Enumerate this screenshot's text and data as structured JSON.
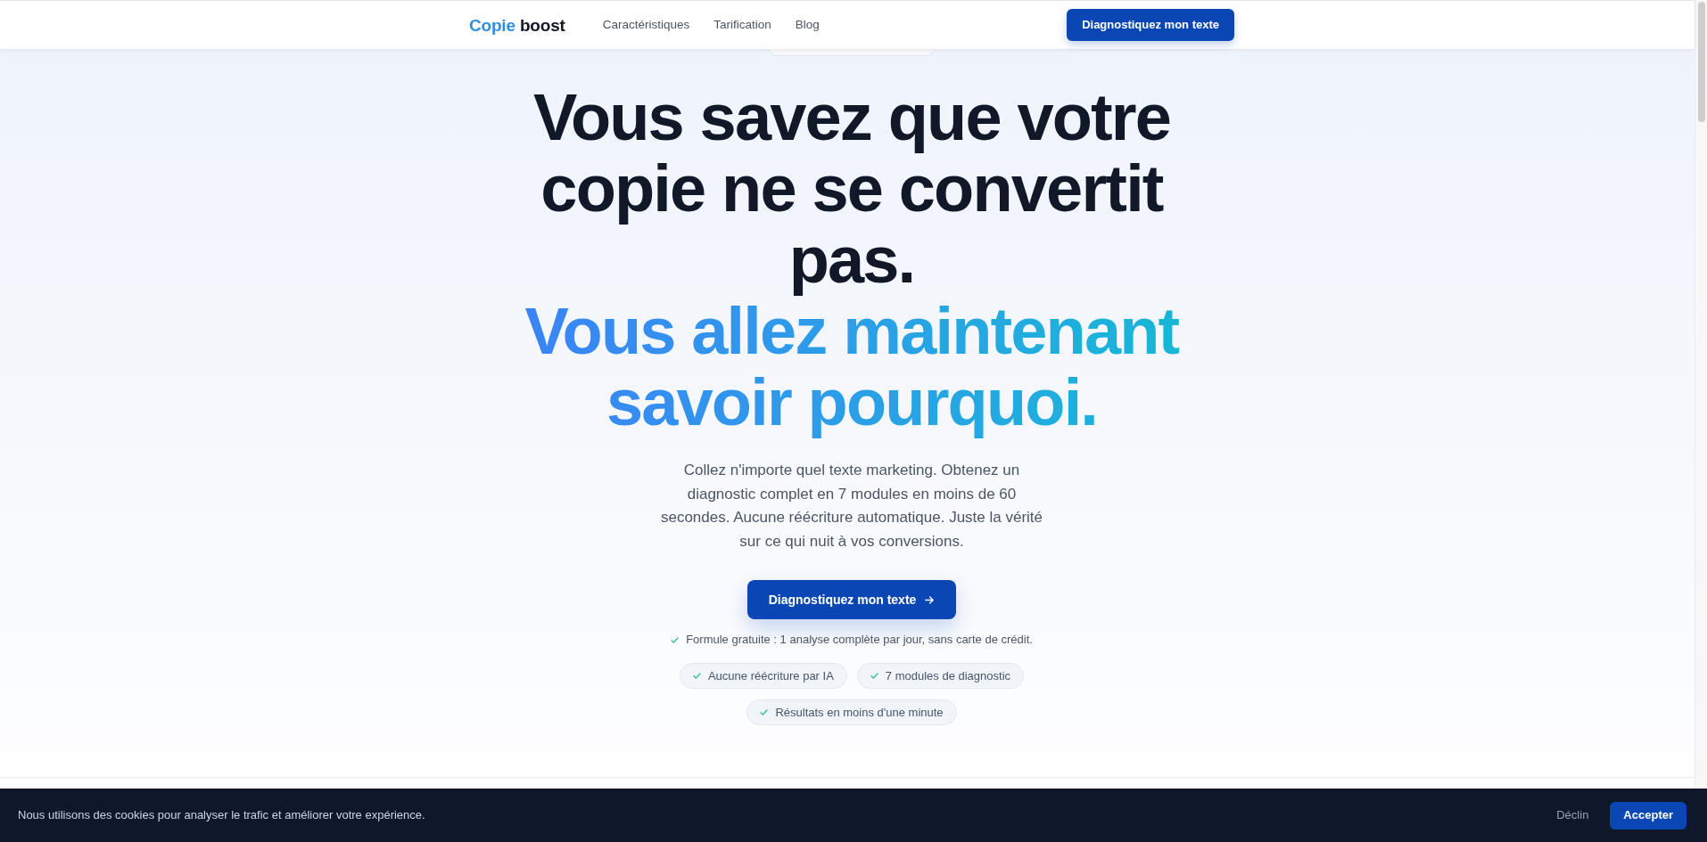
{
  "nav": {
    "logo": {
      "accent": "Copie",
      "text": "boost"
    },
    "links": [
      "Caractéristiques",
      "Tarification",
      "Blog"
    ],
    "cta": "Diagnostiquez mon texte"
  },
  "hero": {
    "heading": "Vous savez que votre copie ne se convertit pas.",
    "highlight": "Vous allez maintenant savoir pourquoi.",
    "description": "Collez n'importe quel texte marketing. Obtenez un diagnostic complet en 7 modules en moins de 60 secondes. Aucune réécriture automatique. Juste la vérité sur ce qui nuit à vos conversions.",
    "cta": "Diagnostiquez mon texte",
    "note": "Formule gratuite : 1 analyse complète par jour, sans carte de crédit.",
    "features": [
      "Aucune réécriture par IA",
      "7 modules de diagnostic",
      "Résultats en moins d'une minute"
    ]
  },
  "cookie_banner": {
    "message": "Nous utilisons des cookies pour analyser le trafic et améliorer votre expérience.",
    "decline": "Déclin",
    "accept": "Accepter"
  }
}
